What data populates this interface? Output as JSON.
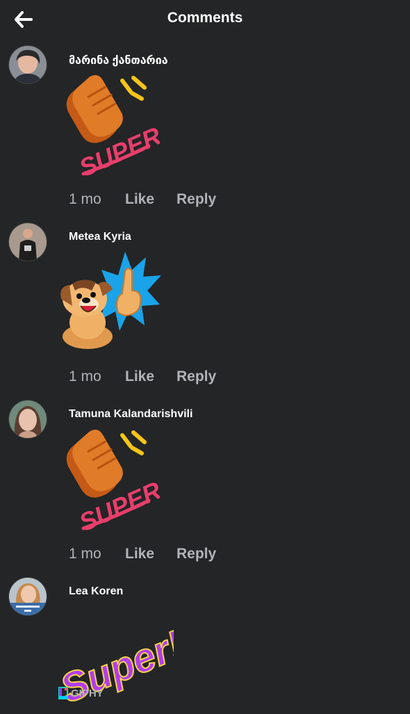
{
  "header": {
    "title": "Comments",
    "back_icon": "arrow-left-icon"
  },
  "comments": [
    {
      "name": "მარინა ქანთარია",
      "sticker": "clapping-hands-super-sticker",
      "time": "1 mo",
      "like": "Like",
      "reply": "Reply"
    },
    {
      "name": "Metea Kyria",
      "sticker": "puppy-thumbs-up-sticker",
      "time": "1 mo",
      "like": "Like",
      "reply": "Reply"
    },
    {
      "name": "Tamuna Kalandarishvili",
      "sticker": "clapping-hands-super-sticker",
      "time": "1 mo",
      "like": "Like",
      "reply": "Reply"
    },
    {
      "name": "Lea Koren",
      "sticker": "super-text-sticker",
      "time": "",
      "like": "",
      "reply": ""
    }
  ],
  "sticker_texts": {
    "super_upper": "SUPER!",
    "super_lower": "Super!"
  },
  "giphy": {
    "label": "GIPHY",
    "icon": "giphy-logo-icon"
  },
  "colors": {
    "background": "#242526",
    "text_primary": "#ffffff",
    "text_secondary": "#b0b3b8",
    "accent_pink": "#e83e6c",
    "accent_purple": "#b23cf0"
  }
}
